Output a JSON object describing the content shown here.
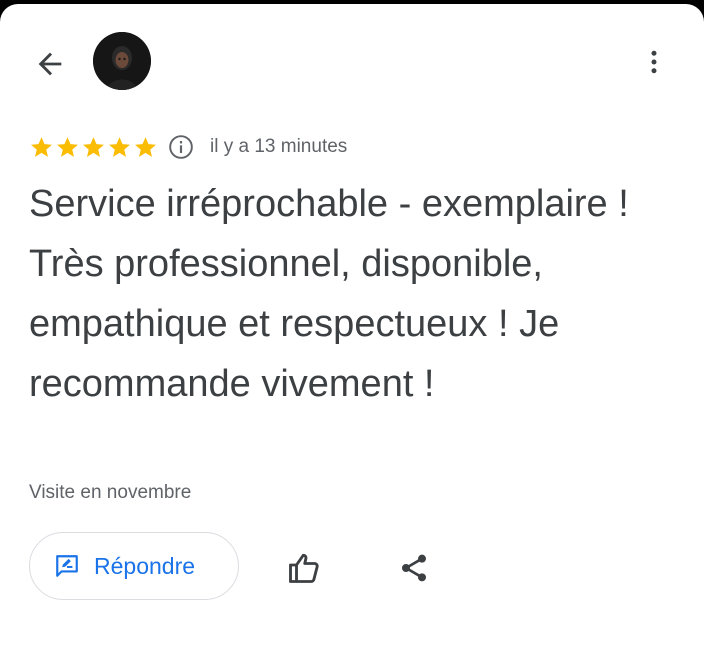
{
  "header": {
    "back_icon": "arrow-left-icon",
    "avatar_icon": "user-avatar",
    "more_icon": "more-vert-icon"
  },
  "review": {
    "rating": 5,
    "max_rating": 5,
    "star_color": "#fbbc04",
    "info_icon": "info-icon",
    "time_ago": "il y a 13 minutes",
    "text": "Service irréprochable - exemplaire ! Très professionnel, disponible, empathique et respectueux ! Je recommande vivement !",
    "visit": "Visite en novembre"
  },
  "actions": {
    "reply_label": "Répondre",
    "reply_icon": "reply-review-icon",
    "like_icon": "thumb-up-icon",
    "share_icon": "share-icon",
    "accent_color": "#1a73e8"
  }
}
